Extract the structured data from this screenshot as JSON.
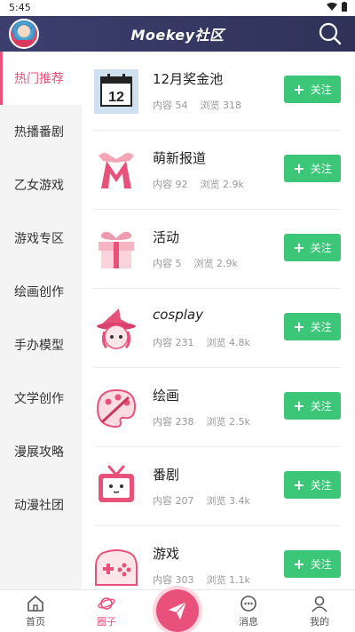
{
  "status_bar": {
    "time": "5:45"
  },
  "header": {
    "title": "Moekey社区"
  },
  "sidebar": {
    "items": [
      {
        "label": "热门推荐",
        "active": true
      },
      {
        "label": "热播番剧"
      },
      {
        "label": "乙女游戏"
      },
      {
        "label": "游戏专区"
      },
      {
        "label": "绘画创作"
      },
      {
        "label": "手办模型"
      },
      {
        "label": "文学创作"
      },
      {
        "label": "漫展攻略"
      },
      {
        "label": "动漫社团"
      }
    ]
  },
  "communities": [
    {
      "name": "12月奖金池",
      "content_label": "内容",
      "content": "54",
      "views_label": "浏览",
      "views": "318",
      "follow_label": "关注",
      "icon": "calendar-12-icon"
    },
    {
      "name": "萌新报道",
      "content_label": "内容",
      "content": "92",
      "views_label": "浏览",
      "views": "2.9k",
      "follow_label": "关注",
      "icon": "m-ribbon-icon"
    },
    {
      "name": "活动",
      "content_label": "内容",
      "content": "5",
      "views_label": "浏览",
      "views": "2.9k",
      "follow_label": "关注",
      "icon": "gift-icon"
    },
    {
      "name": "cosplay",
      "content_label": "内容",
      "content": "231",
      "views_label": "浏览",
      "views": "4.8k",
      "follow_label": "关注",
      "icon": "witch-girl-icon"
    },
    {
      "name": "绘画",
      "content_label": "内容",
      "content": "238",
      "views_label": "浏览",
      "views": "2.5k",
      "follow_label": "关注",
      "icon": "palette-icon"
    },
    {
      "name": "番剧",
      "content_label": "内容",
      "content": "207",
      "views_label": "浏览",
      "views": "3.4k",
      "follow_label": "关注",
      "icon": "tv-icon"
    },
    {
      "name": "游戏",
      "content_label": "内容",
      "content": "303",
      "views_label": "浏览",
      "views": "1.1k",
      "follow_label": "关注",
      "icon": "gamepad-icon"
    }
  ],
  "tabbar": {
    "home": "首页",
    "circle": "圈子",
    "messages": "消息",
    "mine": "我的"
  },
  "colors": {
    "accent": "#e8527a",
    "follow": "#3cc778",
    "header": "#3c3f6e"
  }
}
